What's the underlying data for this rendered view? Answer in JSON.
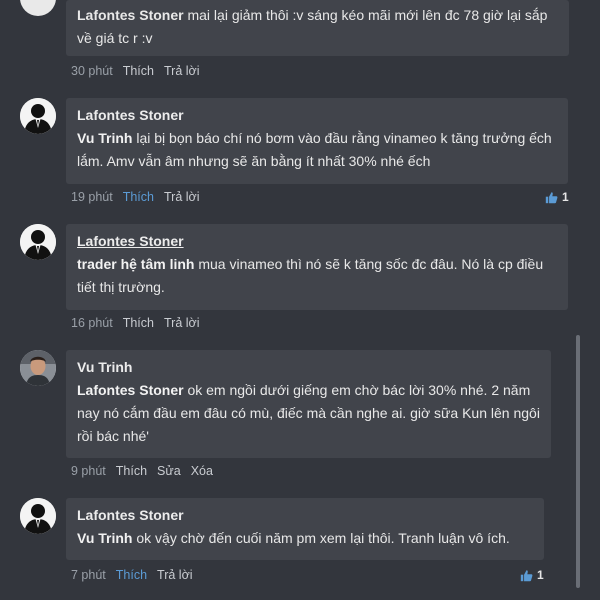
{
  "comments": [
    {
      "author": "Lafontes Stoner",
      "mention": "",
      "text": "mai lại giảm thôi :v sáng kéo mãi mới lên đc 78 giờ lại sắp về giá tc r :v",
      "time": "30 phút",
      "actions": [
        "Thích",
        "Trả lời"
      ],
      "liked": false,
      "likes": ""
    },
    {
      "author": "Lafontes Stoner",
      "mention": "Vu Trinh",
      "text": "lại bị bọn báo chí nó bơm vào đầu rằng vinameo k tăng trưởng ếch lắm. Amv vẫn âm nhưng sẽ ăn bằng ít nhất 30% nhé ếch",
      "time": "19 phút",
      "actions": [
        "Thích",
        "Trả lời"
      ],
      "liked": true,
      "likes": "1"
    },
    {
      "author": "Lafontes Stoner",
      "mention": "trader hệ tâm linh",
      "text": "mua vinameo thì nó sẽ k tăng sốc đc đâu. Nó là cp điều tiết thị trường.",
      "time": "16 phút",
      "actions": [
        "Thích",
        "Trả lời"
      ],
      "liked": false,
      "likes": ""
    },
    {
      "author": "Vu Trinh",
      "mention": "Lafontes Stoner",
      "text": "ok em ngồi dưới giếng em chờ bác lời 30% nhé. 2 năm nay nó cắm đầu em đâu có mù, điếc mà cần nghe ai. giờ sữa Kun lên ngôi rồi bác nhé'",
      "time": "9 phút",
      "actions": [
        "Thích",
        "Sửa",
        "Xóa"
      ],
      "liked": false,
      "likes": ""
    },
    {
      "author": "Lafontes Stoner",
      "mention": "Vu Trinh",
      "text": "ok vậy chờ đến cuối năm pm xem lại thôi. Tranh luận vô ích.",
      "time": "7 phút",
      "actions": [
        "Thích",
        "Trả lời"
      ],
      "liked": true,
      "likes": "1"
    }
  ],
  "colors": {
    "background": "#33363d",
    "bubble": "#41444b",
    "liked": "#5b9bd5"
  },
  "icons": {
    "avatar_default": "silhouette-suit-avatar",
    "avatar_user": "profile-photo-avatar",
    "like": "thumbs-up-icon"
  }
}
